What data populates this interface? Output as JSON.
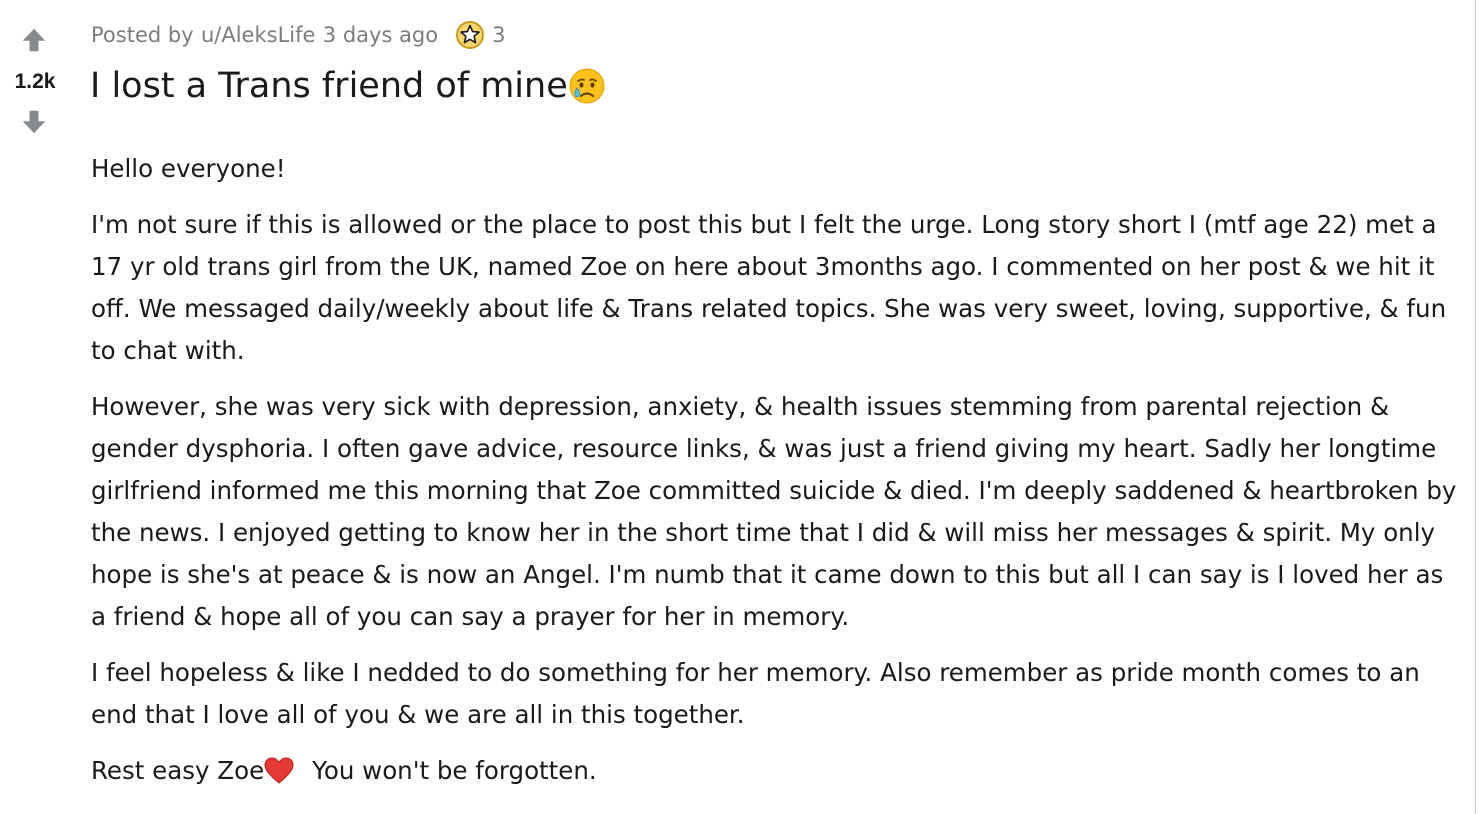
{
  "post": {
    "votes": {
      "score": "1.2k",
      "upvote_icon": "arrow-up-icon",
      "downvote_icon": "arrow-down-icon"
    },
    "meta": {
      "posted_by": "Posted by",
      "author": "u/AleksLife",
      "time": "3 days ago",
      "award_icon": "award-icon",
      "award_count": "3"
    },
    "title": "I lost a Trans friend of mine",
    "title_emoji": "crying-face-icon",
    "body": {
      "paragraphs": [
        "Hello everyone!",
        "I'm not sure if this is allowed or the place to post this but I felt the urge. Long story short I (mtf age 22) met a 17 yr old trans girl from the UK, named Zoe on here about 3months ago. I commented on her post & we hit it off. We messaged daily/weekly about life & Trans related topics. She was very sweet, loving, supportive, & fun to chat with.",
        "However, she was very sick with depression, anxiety, & health issues stemming from parental rejection & gender dysphoria. I often gave advice, resource links, & was just a friend giving my heart. Sadly her longtime girlfriend informed me this morning that Zoe committed suicide & died. I'm deeply saddened & heartbroken by the news. I enjoyed getting to know her in the short time that I did & will miss her messages & spirit. My only hope is she's at peace & is now an Angel. I'm numb that it came down to this but all I can say is I loved her as a friend & hope all of you can say a prayer for her in memory.",
        "I feel hopeless & like I nedded to do something for her memory. Also remember as pride month comes to an end that I love all of you & we are all in this together."
      ],
      "closing_part1": "Rest easy Zoe",
      "closing_emoji": "red-heart-icon",
      "closing_part2": "You won't be forgotten."
    },
    "colors": {
      "text": "#1a1a1b",
      "meta": "#7c7c7c",
      "vote_arrow": "#878a8c",
      "award_gold": "#f2c94c"
    }
  }
}
